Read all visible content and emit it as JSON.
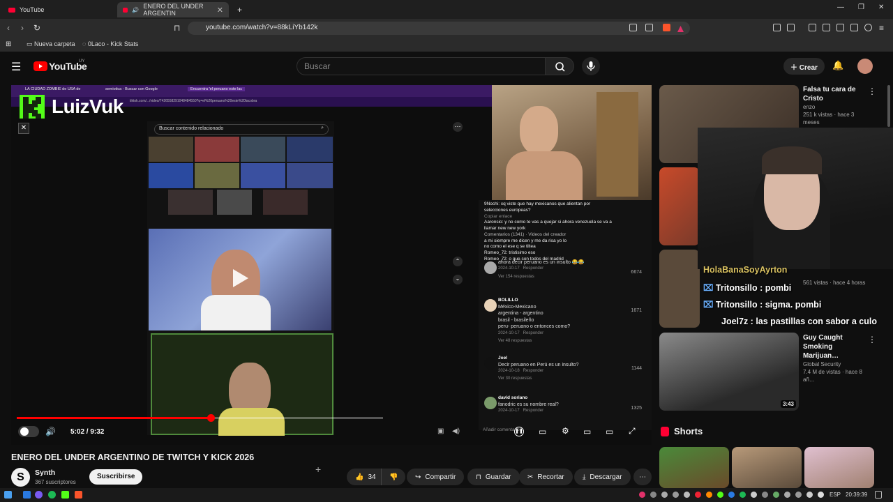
{
  "browser": {
    "tabs": [
      {
        "label": "YouTube"
      },
      {
        "label": "ENERO DEL UNDER ARGENTIN"
      }
    ],
    "url": "youtube.com/watch?v=88kLiYb142k",
    "bookmarks": [
      "Nueva carpeta",
      "0Laco - Kick Stats"
    ]
  },
  "youtube": {
    "logo": "YouTube",
    "region": "UY",
    "search_placeholder": "Buscar",
    "create_label": "Crear"
  },
  "player": {
    "inner_browser_tabs": [
      "LA CIUDAD ZOMBIE de USA de",
      "semiotica - Buscar con Google",
      "Encuentra 'el peruano este lac"
    ],
    "inner_url": "tiktok.com/.../video/7426558291048484550?q=el%20peruano%20este%20lacobra",
    "stream_logo": "LuizVuk",
    "tiktok_search": "Buscar contenido relacionado",
    "time": "5:02 / 9:32",
    "progress": 0.53,
    "top_comments": [
      "9Nochi: xq viste que hay mexicanos que alientan por",
      "selecciones europeas?",
      "Aaronsio: y no como te vas a quejar si ahora venezuela se va a",
      "llamar new new york",
      "a mi siempre me dicen    y me da risa    yo lo",
      "no como el    ese q se tiltea",
      "Romeo_72: tristisimo eso",
      "Romeo_72: o que son todos del madrid"
    ],
    "copy_link": "Copiar enlace",
    "comments_count": "Comentarios (1341)",
    "creator_videos": "Videos del creador",
    "comments": [
      {
        "user": "",
        "text": "ahora decir peruano es un insulto 😂😂",
        "date": "2024-10-17",
        "reply": "Responder",
        "likes": "6674",
        "replies": "Ver 154 respuestas"
      },
      {
        "user": "BOLILLO",
        "text": "México-Mexicano\nargentina - argentino\nbrasil - brasileño\nperu- peruano o entonces como?",
        "date": "2024-10-17",
        "reply": "Responder",
        "likes": "1671",
        "replies": "Ver 48 respuestas"
      },
      {
        "user": "Joel",
        "text": "Decir peruano en Perú es un insulto?",
        "date": "2024-10-18",
        "reply": "Responder",
        "likes": "1144",
        "replies": "Ver 30 respuestas"
      },
      {
        "user": "david soriano",
        "text": "fanodric es su nombre real?",
        "date": "2024-10-17",
        "reply": "Responder",
        "likes": "1325"
      }
    ],
    "add_comment": "Añadir comentario..."
  },
  "chat_overlay": [
    "HolaBanaSoyAyrton",
    "Tritonsillo :    pombi",
    "Tritonsillo : sigma. pombi",
    "Joel7z : las pastillas con sabor a culo"
  ],
  "video": {
    "title": "ENERO DEL UNDER ARGENTINO DE TWITCH Y KICK 2026",
    "channel": "Synth",
    "subscribers": "367 suscriptores",
    "subscribe": "Suscribirse",
    "likes": "34",
    "share": "Compartir",
    "save": "Guardar",
    "clip": "Recortar",
    "download": "Descargar"
  },
  "recommendations": [
    {
      "title": "Falsa tu cara de Cristo",
      "channel": "enzo",
      "meta": "251 k vistas · hace 3 meses"
    },
    {
      "title": "",
      "channel": "",
      "meta": "561 vistas · hace 4 horas"
    },
    {
      "title": "Guy Caught Smoking Marijuan…",
      "channel": "Global Security",
      "meta": "7.4 M de vistas · hace 8 añ…",
      "duration": "3:43"
    }
  ],
  "shorts_label": "Shorts",
  "taskbar": {
    "lang": "ESP",
    "time": "20:39:39"
  },
  "colors": {
    "accent_red": "#ff0000",
    "kick_green": "#53fc18",
    "yt_bg": "#0f0f0f"
  }
}
